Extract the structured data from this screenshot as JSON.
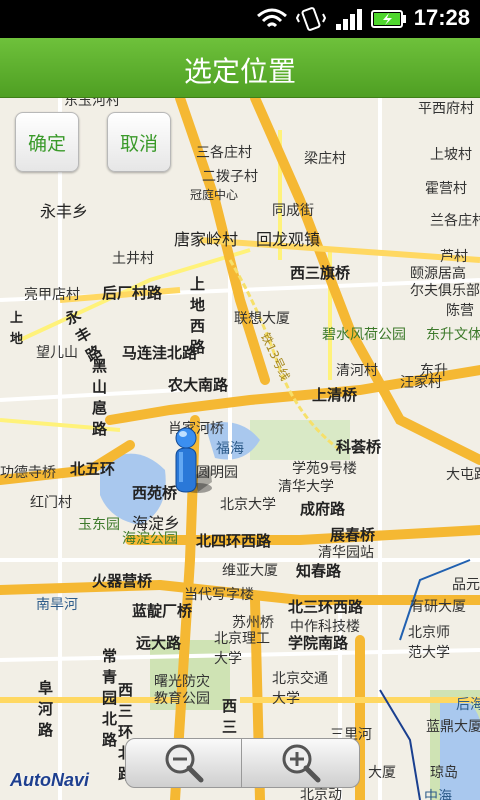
{
  "status_bar": {
    "time": "17:28",
    "icons": [
      "wifi-icon",
      "vibrate-icon",
      "signal-icon",
      "battery-charging-icon"
    ],
    "battery_color": "#4fd62e"
  },
  "title_bar": {
    "title": "选定位置",
    "color": "#5cae2c"
  },
  "buttons": {
    "confirm": "确定",
    "cancel": "取消"
  },
  "map": {
    "labels": [
      "东玉河村",
      "平西府村",
      "三各庄村",
      "梁庄村",
      "上坡村",
      "二拨子村",
      "冠庭中心",
      "霍营村",
      "永丰乡",
      "同成街",
      "兰各庄村",
      "唐家岭村",
      "回龙观镇",
      "芦村",
      "土井村",
      "西三旗桥",
      "颐源居高",
      "尔夫俱乐部",
      "亮甲店村",
      "后厂村路",
      "上地西路",
      "陈营",
      "联想大厦",
      "永丰路",
      "碧水风荷公园",
      "东升文体公园",
      "马连洼北路",
      "清河村",
      "望儿山",
      "黑山扈路",
      "农大南路",
      "汪家村",
      "上清桥",
      "肖家河桥",
      "福海",
      "科荟桥",
      "功德寺桥",
      "北五环",
      "学苑9号楼",
      "清华大学",
      "西苑桥",
      "圆明园",
      "北京大学",
      "大屯路",
      "红门村",
      "成府路",
      "海淀乡",
      "玉东园",
      "海淀公园",
      "展春桥",
      "北四环西路",
      "清华园站",
      "火器营桥",
      "维亚大厦",
      "知春路",
      "当代写字楼",
      "品元",
      "南旱河",
      "蓝靛厂桥",
      "北三环西路",
      "有研大厦",
      "苏州桥",
      "中作科技楼",
      "北京理工大学",
      "远大路",
      "学院南路",
      "北京师范大学",
      "常青园北路",
      "曙光防灾教育公园",
      "北京交通大学",
      "阜河路",
      "西三环北路",
      "西三环",
      "后海",
      "蓝鼎大厦",
      "三里河",
      "大厦",
      "琼岛",
      "北京动",
      "中海",
      "上地",
      "铁13号线",
      "东升"
    ]
  },
  "zoom": {
    "zoom_out_icon": "zoom-out-icon",
    "zoom_in_icon": "zoom-in-icon"
  },
  "logo": "AutoNavi"
}
